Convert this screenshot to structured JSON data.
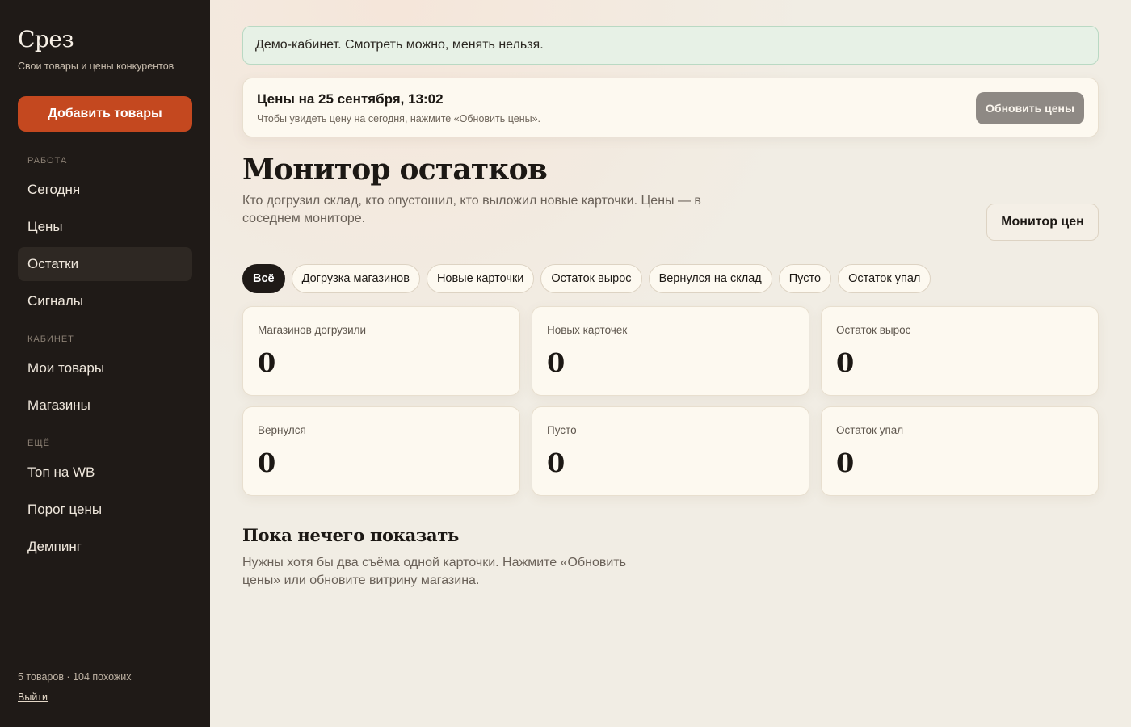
{
  "sidebar": {
    "brand": "Срез",
    "tagline": "Свои товары и цены конкурентов",
    "add_button": "Добавить товары",
    "sections": [
      {
        "title": "РАБОТА",
        "items": [
          "Сегодня",
          "Цены",
          "Остатки",
          "Сигналы"
        ]
      },
      {
        "title": "КАБИНЕТ",
        "items": [
          "Мои товары",
          "Магазины"
        ]
      },
      {
        "title": "ЕЩЁ",
        "items": [
          "Топ на WB",
          "Порог цены",
          "Демпинг"
        ]
      }
    ],
    "active_item": "Остатки",
    "footer_stats": "5 товаров · 104 похожих",
    "logout": "Выйти"
  },
  "banner": {
    "text": "Демо-кабинет. Смотреть можно, менять нельзя."
  },
  "price_card": {
    "title": "Цены на 25 сентября, 13:02",
    "hint": "Чтобы увидеть цену на сегодня, нажмите «Обновить цены».",
    "button": "Обновить цены"
  },
  "page": {
    "title": "Монитор остатков",
    "description": "Кто догрузил склад, кто опустошил, кто выложил новые карточки. Цены — в соседнем мониторе.",
    "monitor_button": "Монитор цен"
  },
  "filters": [
    "Всё",
    "Догрузка магазинов",
    "Новые карточки",
    "Остаток вырос",
    "Вернулся на склад",
    "Пусто",
    "Остаток упал"
  ],
  "active_filter": "Всё",
  "stats": [
    {
      "label": "Магазинов догрузили",
      "value": "0"
    },
    {
      "label": "Новых карточек",
      "value": "0"
    },
    {
      "label": "Остаток вырос",
      "value": "0"
    },
    {
      "label": "Вернулся",
      "value": "0"
    },
    {
      "label": "Пусто",
      "value": "0"
    },
    {
      "label": "Остаток упал",
      "value": "0"
    }
  ],
  "empty_state": {
    "title": "Пока нечего показать",
    "text": "Нужны хотя бы два съёма одной карточки. Нажмите «Обновить цены» или обновите витрину магазина."
  },
  "colors": {
    "sidebar_bg": "#1f1a17",
    "accent": "#c4481f",
    "page_bg": "#f1ede4",
    "banner_bg": "#e7f1e6"
  }
}
